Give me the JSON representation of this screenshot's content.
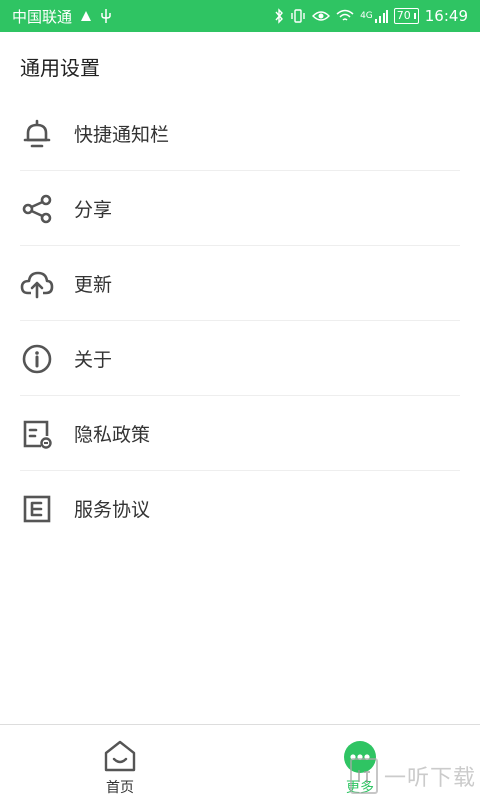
{
  "status_bar": {
    "carrier": "中国联通",
    "network": "4G",
    "battery": "70",
    "time": "16:49"
  },
  "header": {
    "title": "通用设置"
  },
  "menu": {
    "items": [
      {
        "label": "快捷通知栏",
        "icon": "bell-icon"
      },
      {
        "label": "分享",
        "icon": "share-icon"
      },
      {
        "label": "更新",
        "icon": "cloud-upload-icon"
      },
      {
        "label": "关于",
        "icon": "info-icon"
      },
      {
        "label": "隐私政策",
        "icon": "privacy-policy-icon"
      },
      {
        "label": "服务协议",
        "icon": "service-agreement-icon"
      }
    ]
  },
  "bottom_nav": {
    "tabs": [
      {
        "label": "首页",
        "icon": "home-icon",
        "active": false
      },
      {
        "label": "更多",
        "icon": "more-icon",
        "active": true
      }
    ]
  },
  "watermark": {
    "text": "一听下载"
  },
  "colors": {
    "accent": "#2fc463",
    "icon": "#555555",
    "divider": "#eeeeee"
  }
}
